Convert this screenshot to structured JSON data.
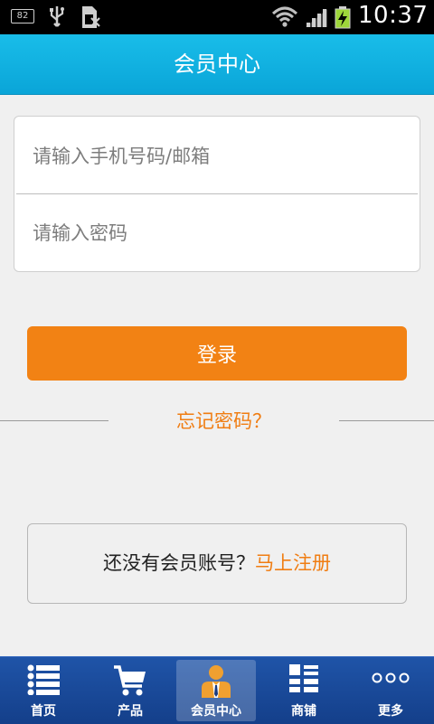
{
  "status_bar": {
    "notification_count": "82",
    "time": "10:37"
  },
  "header": {
    "title": "会员中心"
  },
  "login": {
    "phone_placeholder": "请输入手机号码/邮箱",
    "password_placeholder": "请输入密码",
    "login_label": "登录",
    "forgot_label": "忘记密码？"
  },
  "register": {
    "prompt": "还没有会员账号？",
    "link": "马上注册"
  },
  "bottom_nav": {
    "items": [
      {
        "label": "首页",
        "icon": "list-icon"
      },
      {
        "label": "产品",
        "icon": "cart-icon"
      },
      {
        "label": "会员中心",
        "icon": "member-icon",
        "active": true
      },
      {
        "label": "商铺",
        "icon": "grid-list-icon"
      },
      {
        "label": "更多",
        "icon": "more-dots-icon"
      }
    ]
  },
  "colors": {
    "header": "#12b3e3",
    "accent": "#f28214",
    "nav": "#1a4a9a"
  }
}
